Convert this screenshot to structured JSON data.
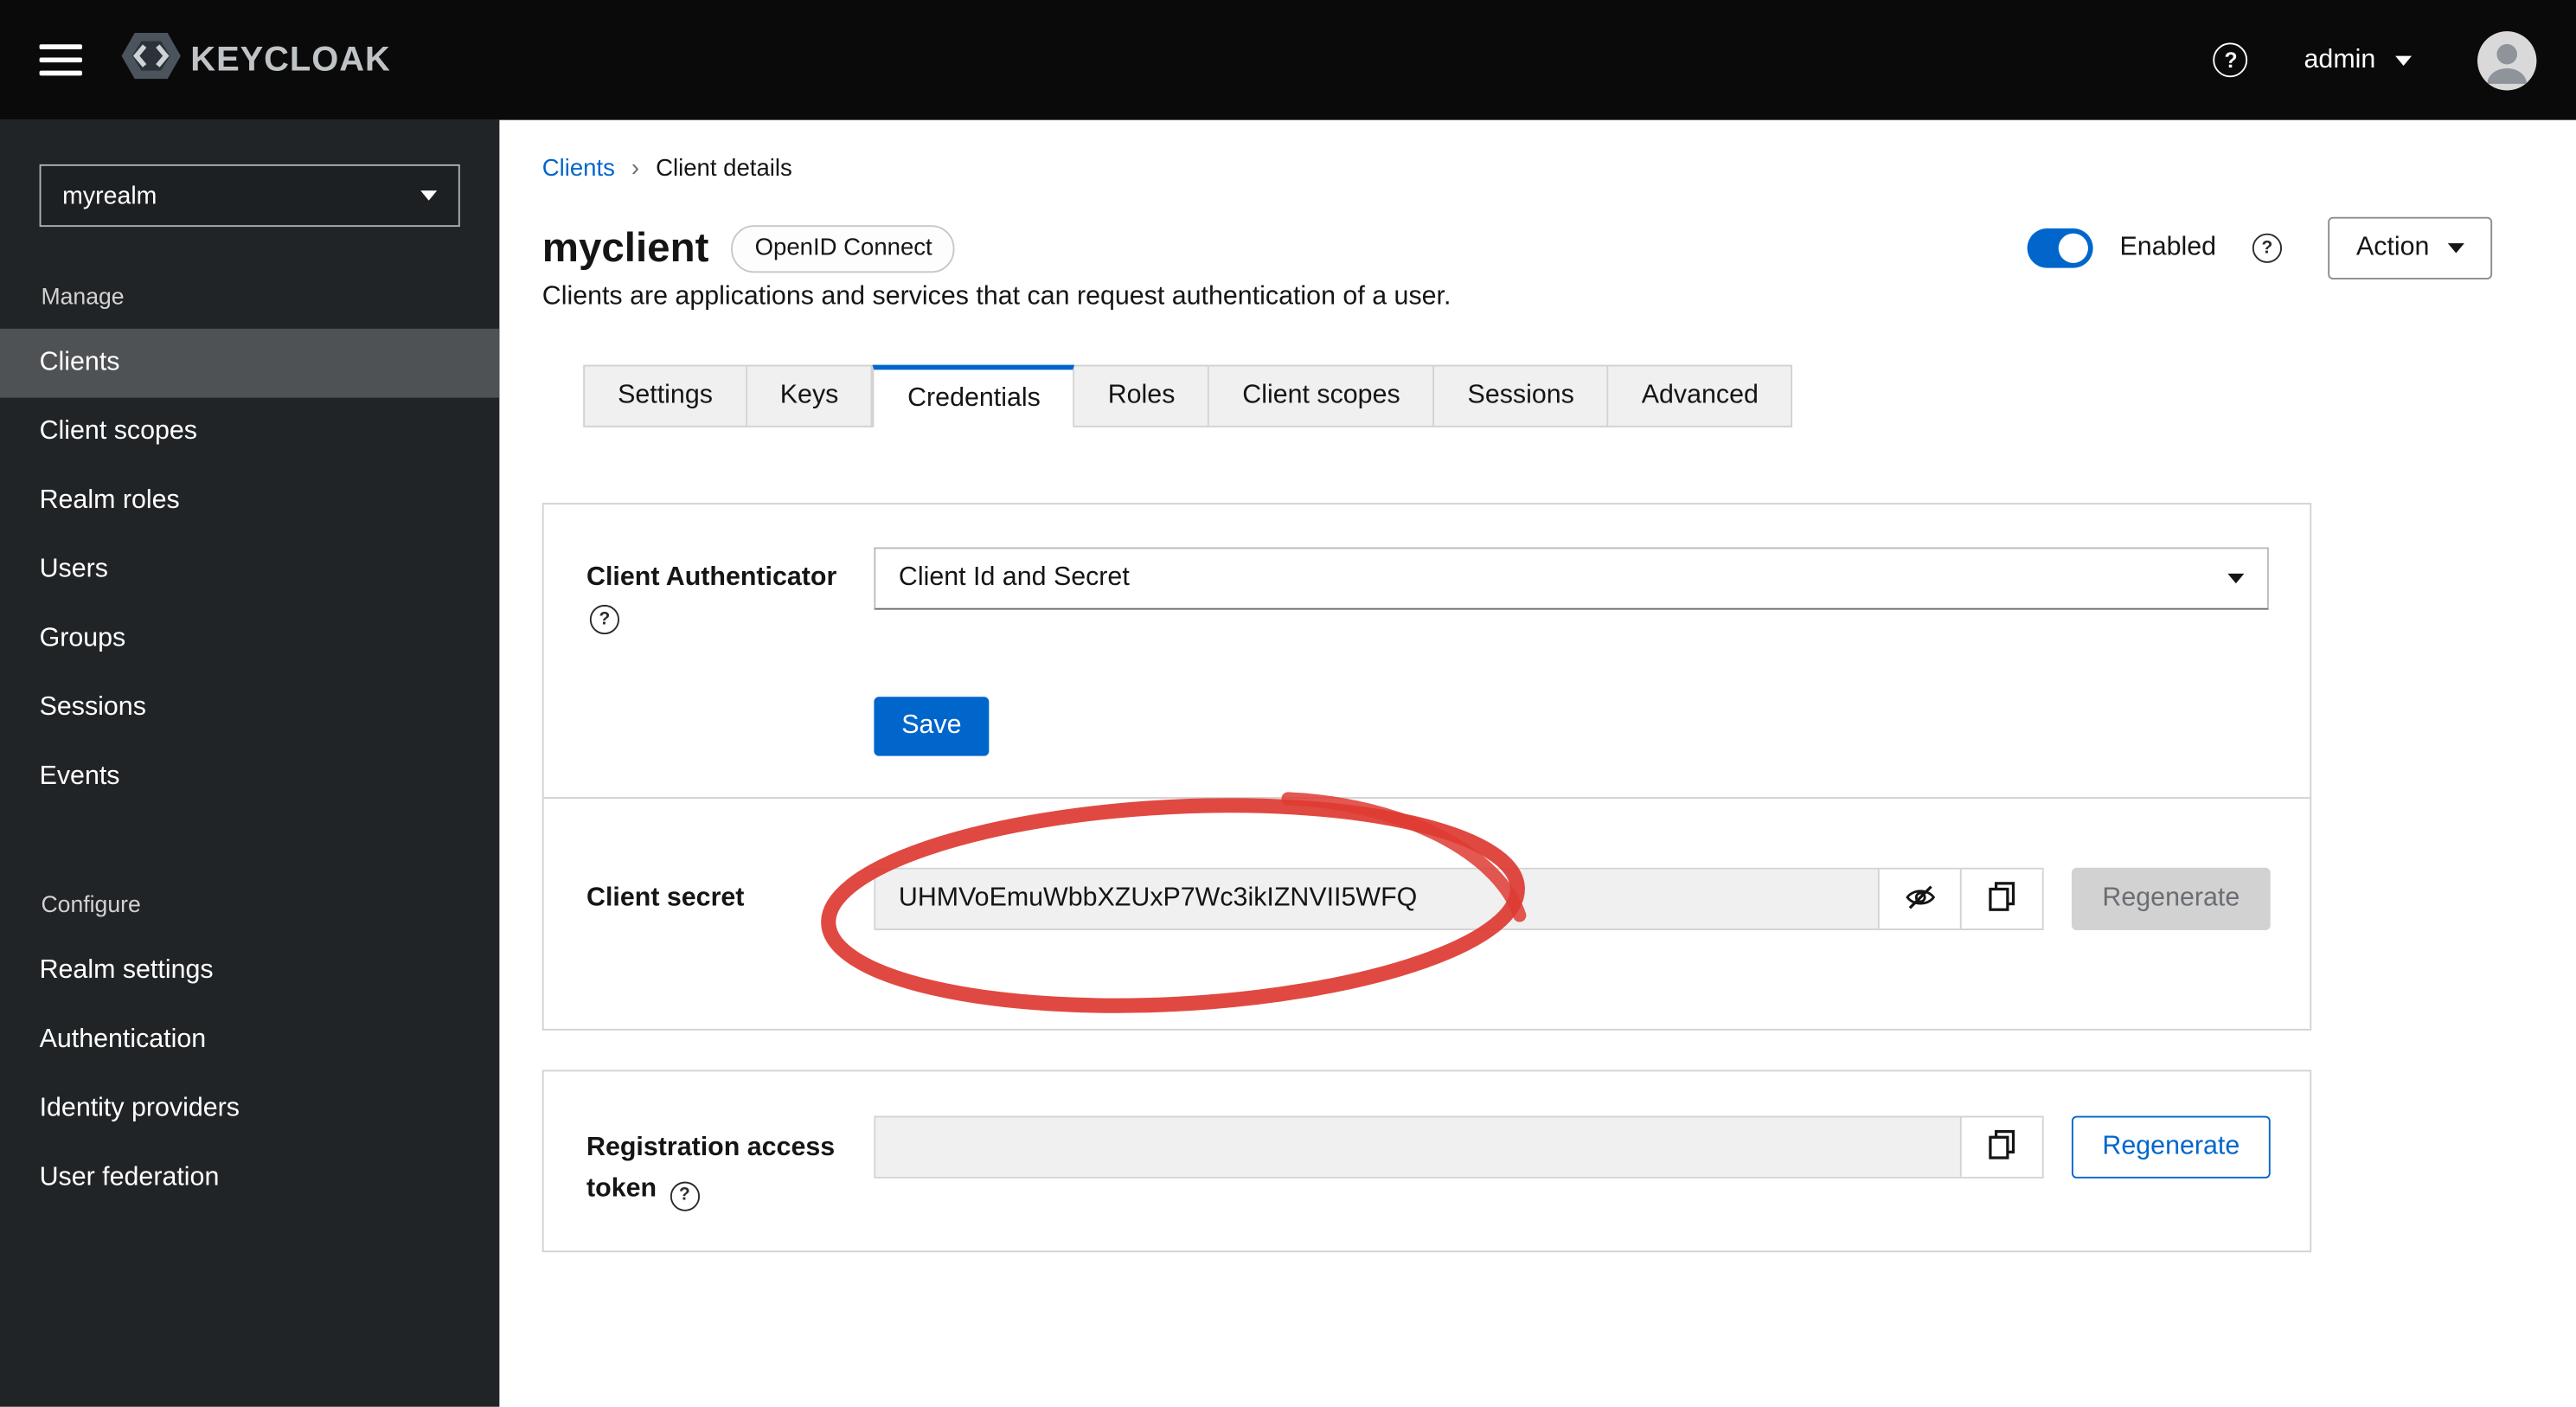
{
  "header": {
    "brand": "KEYCLOAK",
    "user": "admin"
  },
  "icons": {
    "help_glyph": "?"
  },
  "sidebar": {
    "realm_selector": {
      "value": "myrealm"
    },
    "sections": [
      {
        "label": "Manage",
        "items": [
          {
            "label": "Clients",
            "selected": true
          },
          {
            "label": "Client scopes"
          },
          {
            "label": "Realm roles"
          },
          {
            "label": "Users"
          },
          {
            "label": "Groups"
          },
          {
            "label": "Sessions"
          },
          {
            "label": "Events"
          }
        ]
      },
      {
        "label": "Configure",
        "items": [
          {
            "label": "Realm settings"
          },
          {
            "label": "Authentication"
          },
          {
            "label": "Identity providers"
          },
          {
            "label": "User federation"
          }
        ]
      }
    ]
  },
  "breadcrumb": {
    "items": [
      "Clients",
      "Client details"
    ],
    "separator": "›"
  },
  "page": {
    "title": "myclient",
    "badge": "OpenID Connect",
    "description": "Clients are applications and services that can request authentication of a user.",
    "enabled_label": "Enabled",
    "action_label": "Action"
  },
  "tabs": [
    {
      "label": "Settings"
    },
    {
      "label": "Keys"
    },
    {
      "label": "Credentials",
      "active": true
    },
    {
      "label": "Roles"
    },
    {
      "label": "Client scopes"
    },
    {
      "label": "Sessions"
    },
    {
      "label": "Advanced"
    }
  ],
  "cards": {
    "client_authenticator": {
      "label": "Client Authenticator",
      "value": "Client Id and Secret",
      "save_label": "Save"
    },
    "client_secret": {
      "label": "Client secret",
      "value": "UHMVoEmuWbbXZUxP7Wc3ikIZNVII5WFQ",
      "regenerate_label": "Regenerate"
    },
    "registration_token": {
      "label": "Registration access token",
      "value": "",
      "regenerate_label": "Regenerate"
    }
  },
  "colors": {
    "accent_blue": "#0066cc",
    "annotation_red": "#de3b33",
    "masthead_black": "#0a0a0a",
    "sidebar_dark": "#212427"
  }
}
